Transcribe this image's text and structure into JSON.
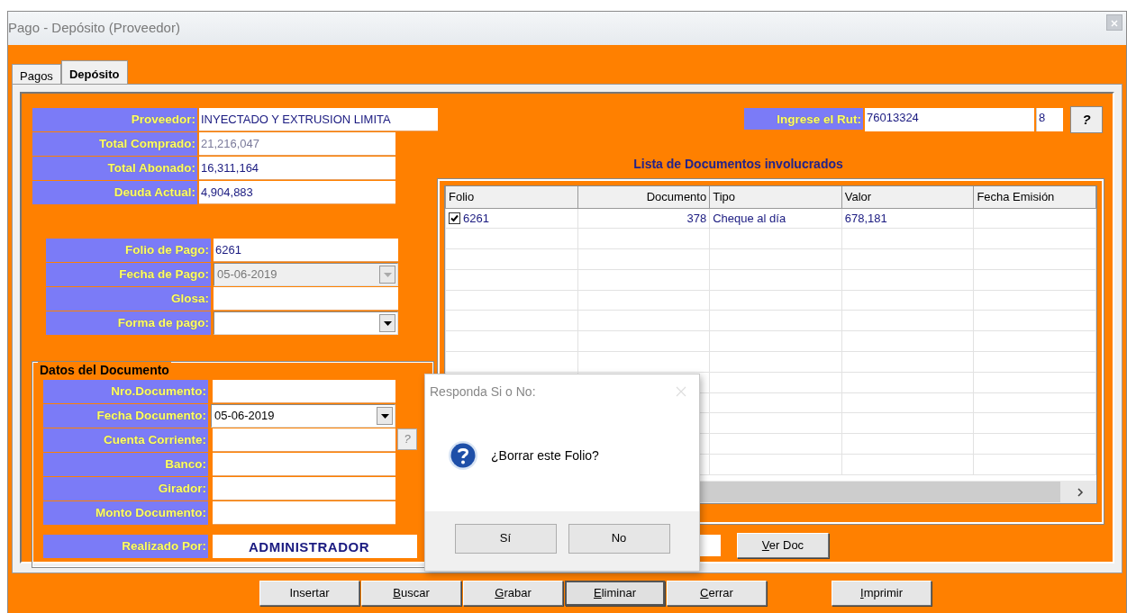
{
  "window": {
    "title": "Pago - Depósito (Proveedor)"
  },
  "tabs": [
    {
      "label": "Pagos",
      "selected": false
    },
    {
      "label": "Depósito",
      "selected": true
    }
  ],
  "summary": [
    {
      "label": "Proveedor:",
      "value": "INYECTADO Y EXTRUSION LIMITA",
      "kind": "wide"
    },
    {
      "label": "Total Comprado:",
      "value": "21,216,047",
      "kind": "muted"
    },
    {
      "label": "Total Abonado:",
      "value": "16,311,164",
      "kind": "plain"
    },
    {
      "label": "Deuda Actual:",
      "value": "4,904,883",
      "kind": "plain"
    }
  ],
  "payment_fields": [
    {
      "label": "Folio de Pago:",
      "value": "6261",
      "kind": "text"
    },
    {
      "label": "Fecha de Pago:",
      "value": "05-06-2019",
      "kind": "dropdown",
      "disabled": true
    },
    {
      "label": "Glosa:",
      "kind": "text"
    },
    {
      "label": "Forma de pago:",
      "kind": "dropdown",
      "disabled": false
    }
  ],
  "document_group": {
    "title": "Datos del Documento",
    "fields": [
      {
        "label": "Nro.Documento:",
        "kind": "text"
      },
      {
        "label": "Fecha Documento:",
        "value": "05-06-2019",
        "kind": "dropdown",
        "disabled": false
      },
      {
        "label": "Cuenta Corriente:",
        "kind": "text",
        "help_button": "?"
      },
      {
        "label": "Banco:",
        "kind": "text"
      },
      {
        "label": "Girador:",
        "kind": "text"
      },
      {
        "label": "Monto Documento:",
        "kind": "text"
      }
    ]
  },
  "realizado_por": {
    "label": "Realizado Por:",
    "value": "ADMINISTRADOR"
  },
  "rut": {
    "label": "Ingrese el Rut:",
    "value": "76013324",
    "check_digit": "8",
    "help_button": "?"
  },
  "documents": {
    "title": "Lista de Documentos involucrados",
    "columns": [
      "Folio",
      "Documento",
      "Tipo",
      "Valor",
      "Fecha Emisión"
    ],
    "rows": [
      {
        "checked": true,
        "folio": "6261",
        "documento": "378",
        "tipo": "Cheque al día",
        "valor": "678,181"
      }
    ]
  },
  "ver_doc_button": {
    "label": "Ver Doc",
    "mnemonic": true
  },
  "buttons": [
    {
      "label": "Insertar",
      "mnemonic": false,
      "focused": false
    },
    {
      "label": "Buscar",
      "mnemonic": true,
      "focused": false
    },
    {
      "label": "Grabar",
      "mnemonic": true,
      "focused": false
    },
    {
      "label": "Eliminar",
      "mnemonic": true,
      "focused": true
    },
    {
      "label": "Cerrar",
      "mnemonic": true,
      "focused": false
    }
  ],
  "print_button": {
    "label": "Imprimir",
    "mnemonic": true
  },
  "dialog": {
    "title": "Responda Si o No:",
    "message": "¿Borrar este Folio?",
    "buttons": [
      {
        "label": "Sí"
      },
      {
        "label": "No"
      }
    ]
  }
}
